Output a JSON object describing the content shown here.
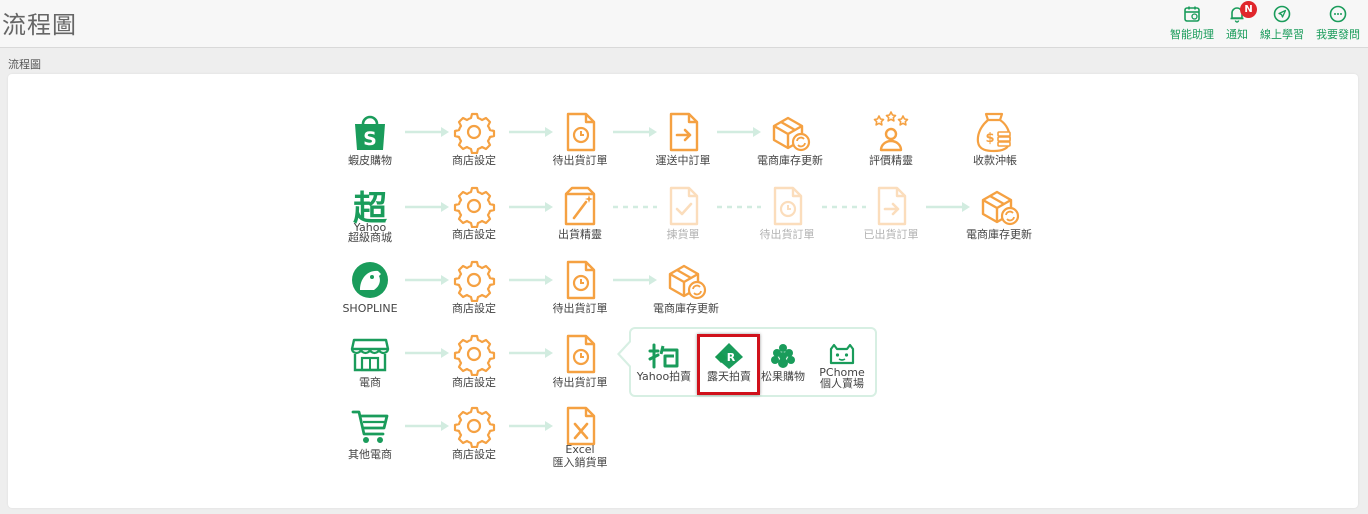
{
  "header": {
    "title": "流程圖",
    "actions": [
      {
        "label": "智能助理",
        "icon": "calendar-icon"
      },
      {
        "label": "通知",
        "icon": "bell-icon",
        "badge": "N"
      },
      {
        "label": "線上學習",
        "icon": "navigation-icon"
      },
      {
        "label": "我要發問",
        "icon": "chat-icon"
      }
    ]
  },
  "breadcrumb": "流程圖",
  "colors": {
    "green": "#1a9c5b",
    "orange": "#f5a142",
    "arrow": "#d2ece0",
    "highlight": "#d0111b"
  },
  "rows": [
    {
      "platform": {
        "label": "蝦皮購物",
        "icon": "shopee-bag-icon"
      },
      "steps": [
        "商店設定",
        "待出貨訂單",
        "運送中訂單",
        "電商庫存更新",
        "評價精靈",
        "收款沖帳"
      ]
    },
    {
      "platform": {
        "label_line1": "Yahoo",
        "label_line2": "超級商城",
        "glyph": "超",
        "icon": "yahoo-mall-icon"
      },
      "steps": [
        "商店設定",
        "出貨精靈",
        "揀貨單",
        "待出貨訂單",
        "已出貨訂單",
        "電商庫存更新"
      ]
    },
    {
      "platform": {
        "label": "SHOPLINE",
        "icon": "shopline-icon"
      },
      "steps": [
        "商店設定",
        "待出貨訂單",
        "電商庫存更新"
      ]
    },
    {
      "platform": {
        "label": "電商",
        "icon": "store-icon"
      },
      "steps": [
        "商店設定",
        "待出貨訂單"
      ]
    },
    {
      "platform": {
        "label": "其他電商",
        "icon": "cart-icon"
      },
      "steps": [
        "商店設定",
        "Excel",
        "匯入銷貨單"
      ]
    }
  ],
  "popup": {
    "items": [
      {
        "label": "Yahoo拍賣",
        "icon": "yahoo-auction-icon"
      },
      {
        "label": "露天拍賣",
        "icon": "ruten-icon",
        "glyph": "R"
      },
      {
        "label": "松果購物",
        "icon": "pinecone-icon"
      },
      {
        "label_line1": "PChome",
        "label_line2": "個人賣場",
        "icon": "pchome-cat-icon"
      }
    ]
  }
}
